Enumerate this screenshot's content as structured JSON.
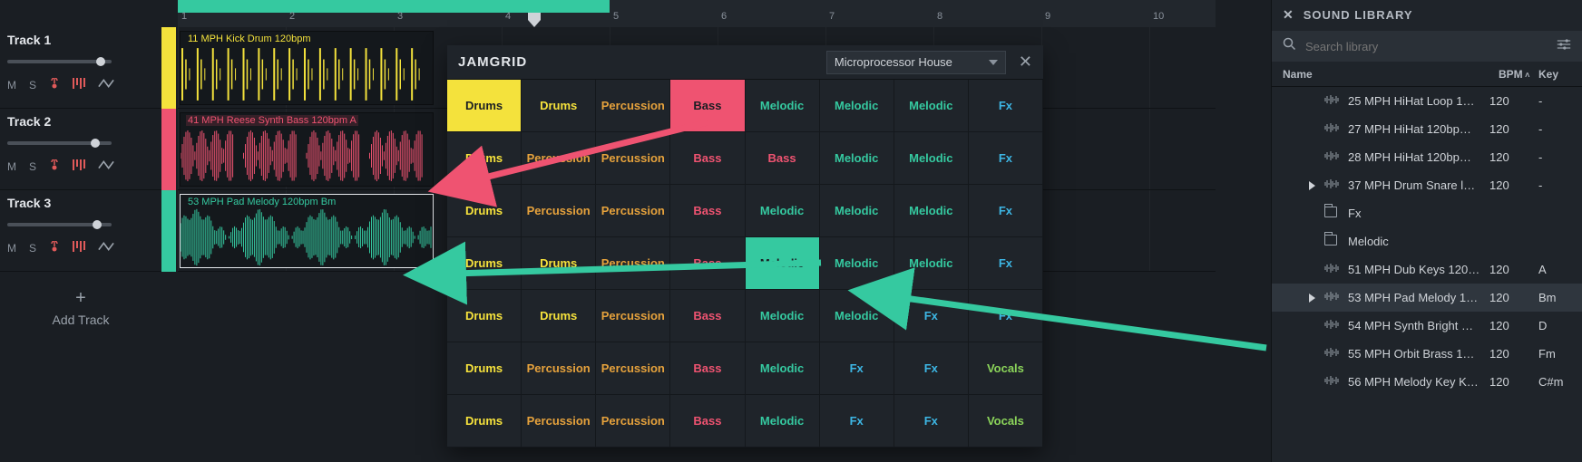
{
  "tracks": [
    {
      "name": "Track 1",
      "vol": 0.85,
      "clip_label": "11 MPH Kick Drum 120bpm"
    },
    {
      "name": "Track 2",
      "vol": 0.8,
      "clip_label": "41 MPH Reese Synth Bass 120bpm A"
    },
    {
      "name": "Track 3",
      "vol": 0.82,
      "clip_label": "53 MPH Pad Melody 120bpm Bm"
    }
  ],
  "add_track_label": "Add Track",
  "track_tools": {
    "mute": "M",
    "solo": "S"
  },
  "timeline": {
    "loop_start": 1,
    "loop_end": 5,
    "playhead": 4.3,
    "ruler": [
      "1",
      "2",
      "3",
      "4",
      "5",
      "6",
      "7",
      "8",
      "9",
      "10"
    ]
  },
  "jamgrid": {
    "title": "JAMGRID",
    "preset": "Microprocessor House",
    "rows": [
      [
        [
          "Drums",
          "drums",
          "sel-yellow"
        ],
        [
          "Drums",
          "drums"
        ],
        [
          "Percussion",
          "perc"
        ],
        [
          "Bass",
          "bass",
          "sel-red"
        ],
        [
          "Melodic",
          "melodic"
        ],
        [
          "Melodic",
          "melodic"
        ],
        [
          "Melodic",
          "melodic"
        ],
        [
          "Fx",
          "fx"
        ]
      ],
      [
        [
          "Drums",
          "drums"
        ],
        [
          "Percussion",
          "perc"
        ],
        [
          "Percussion",
          "perc"
        ],
        [
          "Bass",
          "bass"
        ],
        [
          "Bass",
          "bass"
        ],
        [
          "Melodic",
          "melodic"
        ],
        [
          "Melodic",
          "melodic"
        ],
        [
          "Fx",
          "fx"
        ]
      ],
      [
        [
          "Drums",
          "drums"
        ],
        [
          "Percussion",
          "perc"
        ],
        [
          "Percussion",
          "perc"
        ],
        [
          "Bass",
          "bass"
        ],
        [
          "Melodic",
          "melodic"
        ],
        [
          "Melodic",
          "melodic"
        ],
        [
          "Melodic",
          "melodic"
        ],
        [
          "Fx",
          "fx"
        ]
      ],
      [
        [
          "Drums",
          "drums"
        ],
        [
          "Drums",
          "drums"
        ],
        [
          "Percussion",
          "perc"
        ],
        [
          "Bass",
          "bass"
        ],
        [
          "Melodic",
          "melodic",
          "sel-green"
        ],
        [
          "Melodic",
          "melodic"
        ],
        [
          "Melodic",
          "melodic"
        ],
        [
          "Fx",
          "fx"
        ]
      ],
      [
        [
          "Drums",
          "drums"
        ],
        [
          "Drums",
          "drums"
        ],
        [
          "Percussion",
          "perc"
        ],
        [
          "Bass",
          "bass"
        ],
        [
          "Melodic",
          "melodic"
        ],
        [
          "Melodic",
          "melodic"
        ],
        [
          "Fx",
          "fx"
        ],
        [
          "Fx",
          "fx"
        ]
      ],
      [
        [
          "Drums",
          "drums"
        ],
        [
          "Percussion",
          "perc"
        ],
        [
          "Percussion",
          "perc"
        ],
        [
          "Bass",
          "bass"
        ],
        [
          "Melodic",
          "melodic"
        ],
        [
          "Fx",
          "fx"
        ],
        [
          "Fx",
          "fx"
        ],
        [
          "Vocals",
          "vocals"
        ]
      ],
      [
        [
          "Drums",
          "drums"
        ],
        [
          "Percussion",
          "perc"
        ],
        [
          "Percussion",
          "perc"
        ],
        [
          "Bass",
          "bass"
        ],
        [
          "Melodic",
          "melodic"
        ],
        [
          "Fx",
          "fx"
        ],
        [
          "Fx",
          "fx"
        ],
        [
          "Vocals",
          "vocals"
        ]
      ]
    ]
  },
  "library": {
    "title": "SOUND LIBRARY",
    "search_placeholder": "Search library",
    "cols": {
      "name": "Name",
      "bpm": "BPM",
      "key": "Key"
    },
    "items": [
      {
        "type": "sample",
        "name": "25 MPH HiHat Loop 1…",
        "bpm": "120",
        "key": "-"
      },
      {
        "type": "sample",
        "name": "27 MPH HiHat 120bp…",
        "bpm": "120",
        "key": "-"
      },
      {
        "type": "sample",
        "name": "28 MPH HiHat 120bp…",
        "bpm": "120",
        "key": "-"
      },
      {
        "type": "sample",
        "name": "37 MPH Drum Snare loo…",
        "bpm": "120",
        "key": "-",
        "playing": true
      },
      {
        "type": "folder",
        "name": "Fx"
      },
      {
        "type": "folder",
        "name": "Melodic"
      },
      {
        "type": "sample",
        "name": "51 MPH Dub Keys 120…",
        "bpm": "120",
        "key": "A"
      },
      {
        "type": "sample",
        "name": "53 MPH Pad Melody 12…",
        "bpm": "120",
        "key": "Bm",
        "playing": true,
        "selected": true
      },
      {
        "type": "sample",
        "name": "54 MPH Synth Bright …",
        "bpm": "120",
        "key": "D"
      },
      {
        "type": "sample",
        "name": "55 MPH Orbit Brass 1…",
        "bpm": "120",
        "key": "Fm"
      },
      {
        "type": "sample",
        "name": "56 MPH Melody Key Ki…",
        "bpm": "120",
        "key": "C#m"
      }
    ]
  },
  "colors": {
    "yellow": "#f4e23c",
    "red": "#ef5371",
    "green": "#35c9a0",
    "blue": "#3db6e4"
  }
}
